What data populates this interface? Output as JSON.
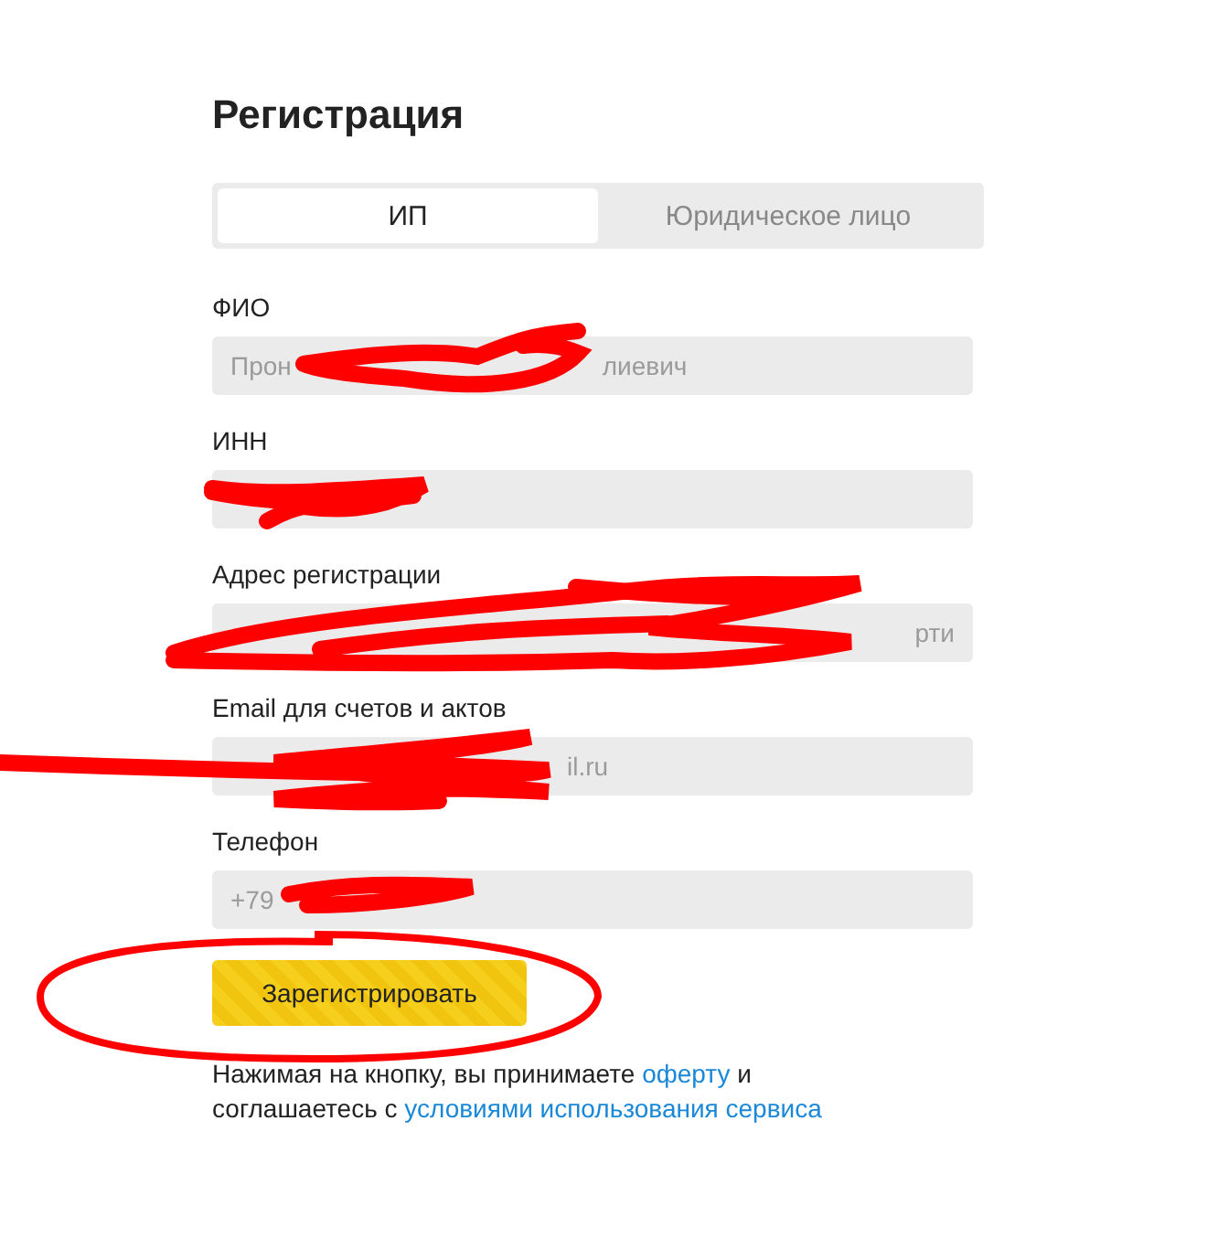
{
  "title": "Регистрация",
  "tabs": [
    {
      "label": "ИП",
      "selected": true
    },
    {
      "label": "Юридическое лицо",
      "selected": false
    }
  ],
  "fields": [
    {
      "label": "ФИО",
      "visible_text": [
        "Прон",
        "лиевич"
      ],
      "redacted": true
    },
    {
      "label": "ИНН",
      "redacted": true
    },
    {
      "label": "Адрес регистрации",
      "visible_text": [
        "рти"
      ],
      "redacted": true
    },
    {
      "label": "Email для счетов и актов",
      "visible_text": [
        "il.ru"
      ],
      "redacted": true
    },
    {
      "label": "Телефон",
      "visible_text": [
        "+79"
      ],
      "redacted": true
    }
  ],
  "submit_button": {
    "label": "Зарегистрировать",
    "circled": true
  },
  "legal_note": {
    "text_before": "Нажимая на кнопку, вы принимаете",
    "link_offer": "оферту",
    "text_middle": "и соглашаетесь с",
    "link_terms": "условиями использования сервиса"
  }
}
